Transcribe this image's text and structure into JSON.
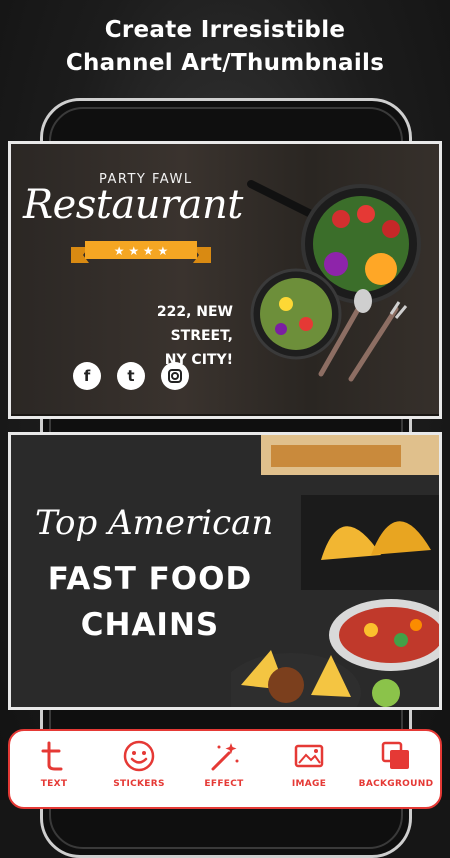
{
  "header": {
    "line1": "Create Irresistible",
    "line2": "Channel Art/Thumbnails"
  },
  "banner1": {
    "tagline": "PARTY FAWL",
    "title": "Restaurant",
    "address_line1": "222, NEW STREET,",
    "address_line2": "NY CITY!",
    "social": [
      "f",
      "t",
      "instagram"
    ]
  },
  "banner2": {
    "script_title": "Top American",
    "line1": "FAST FOOD",
    "line2": "CHAINS"
  },
  "toolbar": {
    "items": [
      {
        "label": "TEXT",
        "icon": "text-icon"
      },
      {
        "label": "STICKERS",
        "icon": "smiley-icon"
      },
      {
        "label": "EFFECT",
        "icon": "magic-wand-icon"
      },
      {
        "label": "IMAGE",
        "icon": "image-icon"
      },
      {
        "label": "BACKGROUND",
        "icon": "layers-icon"
      }
    ]
  },
  "colors": {
    "accent": "#e53935",
    "ribbon": "#f5a623"
  }
}
